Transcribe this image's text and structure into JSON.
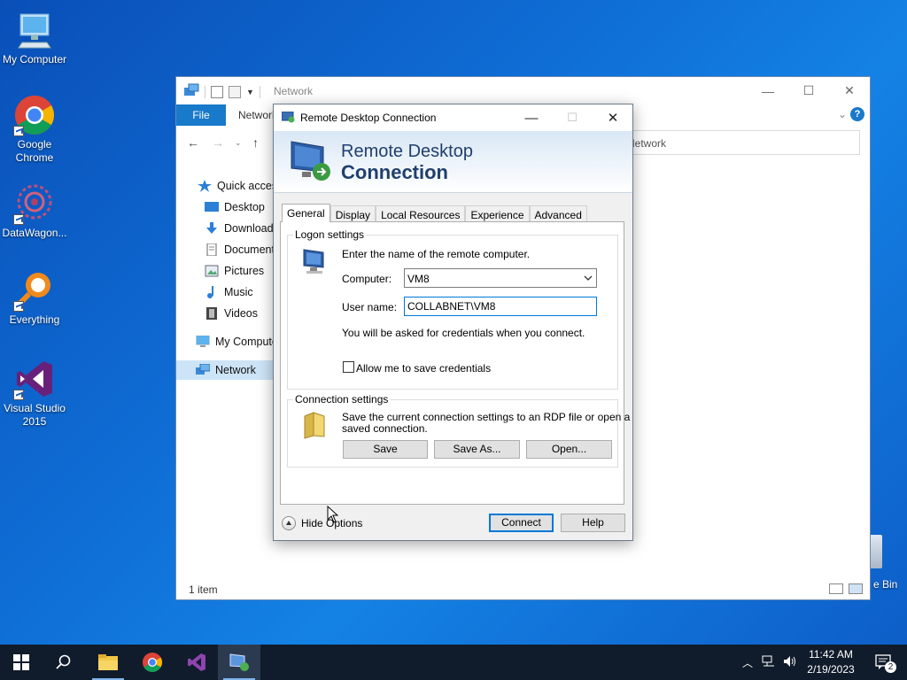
{
  "desktop": {
    "icons": [
      {
        "label": "My Computer"
      },
      {
        "label": "Google Chrome"
      },
      {
        "label": "DataWagon..."
      },
      {
        "label": "Everything"
      },
      {
        "label": "Visual Studio 2015"
      }
    ],
    "recycle_bin_label": "e Bin"
  },
  "explorer": {
    "title": "Network",
    "ribbon": {
      "file_tab": "File",
      "tab_network": "Network"
    },
    "address": "Network",
    "nav_items": [
      {
        "label": "Quick access",
        "icon": "star-icon"
      },
      {
        "label": "Desktop",
        "icon": "desktop-folder-icon"
      },
      {
        "label": "Downloads",
        "icon": "download-icon"
      },
      {
        "label": "Documents",
        "icon": "documents-icon"
      },
      {
        "label": "Pictures",
        "icon": "pictures-icon"
      },
      {
        "label": "Music",
        "icon": "music-icon"
      },
      {
        "label": "Videos",
        "icon": "videos-icon"
      },
      {
        "label": "My Computer",
        "icon": "computer-icon"
      },
      {
        "label": "Network",
        "icon": "network-icon"
      }
    ],
    "status": "1 item"
  },
  "rdp": {
    "title": "Remote Desktop Connection",
    "banner_line1": "Remote Desktop",
    "banner_line2": "Connection",
    "tabs": [
      "General",
      "Display",
      "Local Resources",
      "Experience",
      "Advanced"
    ],
    "logon_group": "Logon settings",
    "logon_instructions": "Enter the name of the remote computer.",
    "computer_label": "Computer:",
    "computer_value": "VM8",
    "username_label": "User name:",
    "username_value": "COLLABNET\\VM8",
    "credentials_note": "You will be asked for credentials when you connect.",
    "save_credentials_label": "Allow me to save credentials",
    "connection_group": "Connection settings",
    "connection_text_line1": "Save the current connection settings to an RDP file or open a",
    "connection_text_line2": "saved connection.",
    "save_button": "Save",
    "save_as_button": "Save As...",
    "open_button": "Open...",
    "hide_options": "Hide Options",
    "connect_button": "Connect",
    "help_button": "Help"
  },
  "taskbar": {
    "time": "11:42 AM",
    "date": "2/19/2023",
    "notification_count": "2"
  }
}
